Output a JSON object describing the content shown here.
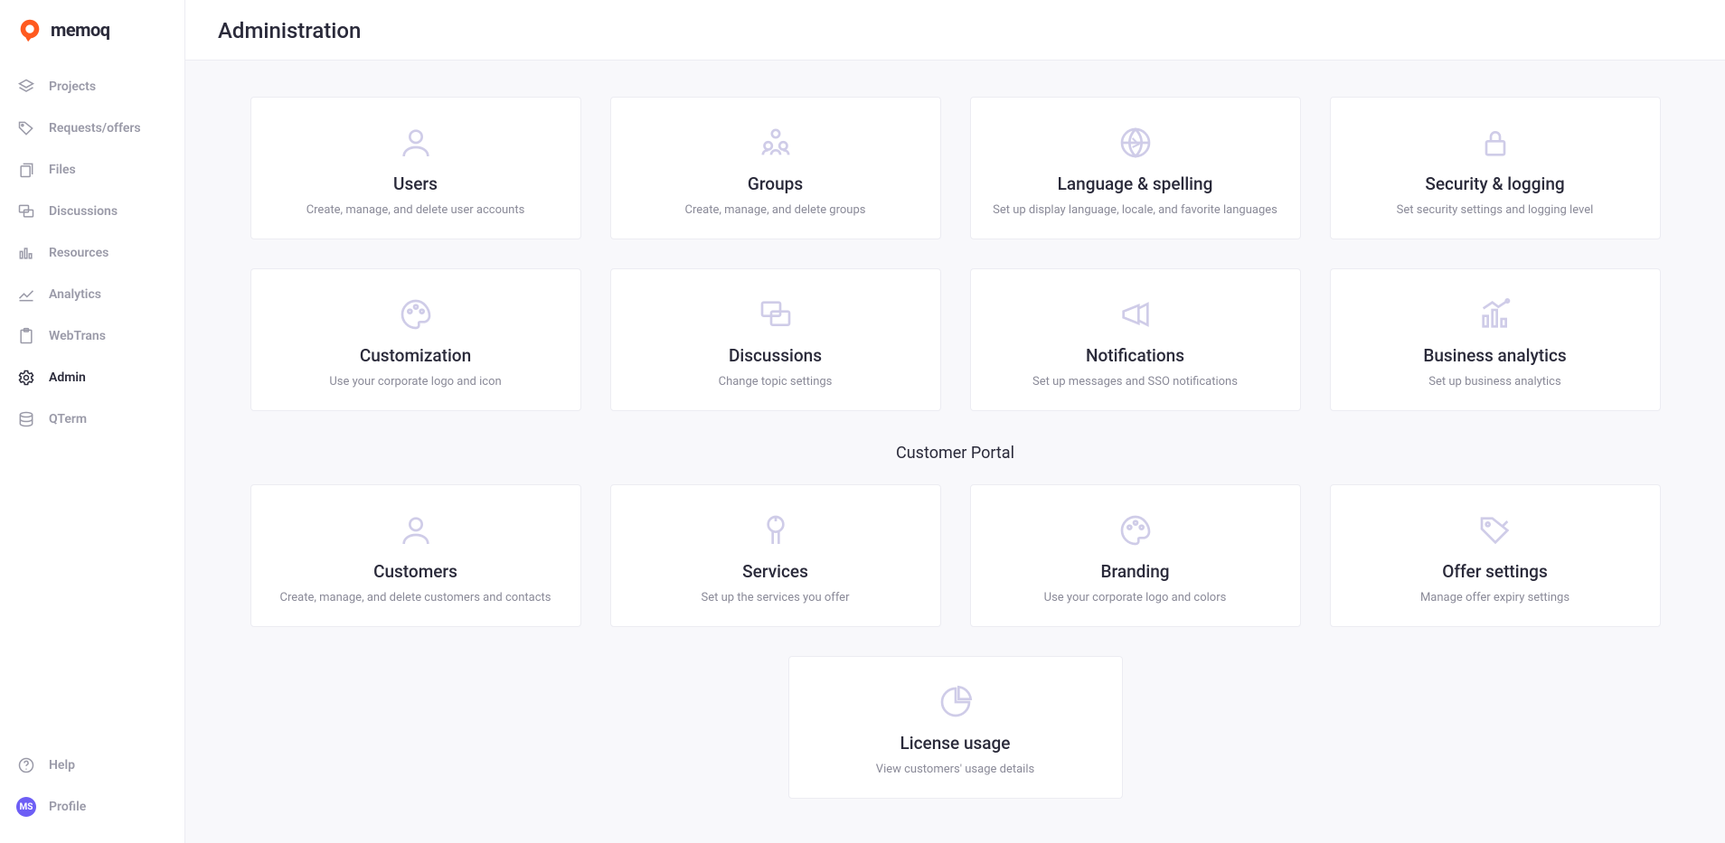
{
  "brand": {
    "name": "memoq"
  },
  "sidebar": {
    "items": [
      {
        "label": "Projects"
      },
      {
        "label": "Requests/offers"
      },
      {
        "label": "Files"
      },
      {
        "label": "Discussions"
      },
      {
        "label": "Resources"
      },
      {
        "label": "Analytics"
      },
      {
        "label": "WebTrans"
      },
      {
        "label": "Admin"
      },
      {
        "label": "QTerm"
      }
    ],
    "bottom": {
      "help": "Help",
      "profile": "Profile",
      "avatar_initials": "MS"
    }
  },
  "header": {
    "title": "Administration"
  },
  "section1": {
    "cards": [
      {
        "title": "Users",
        "desc": "Create, manage, and delete user accounts"
      },
      {
        "title": "Groups",
        "desc": "Create, manage, and delete groups"
      },
      {
        "title": "Language & spelling",
        "desc": "Set up display language, locale, and favorite languages"
      },
      {
        "title": "Security & logging",
        "desc": "Set security settings and logging level"
      },
      {
        "title": "Customization",
        "desc": "Use your corporate logo and icon"
      },
      {
        "title": "Discussions",
        "desc": "Change topic settings"
      },
      {
        "title": "Notifications",
        "desc": "Set up messages and SSO notifications"
      },
      {
        "title": "Business analytics",
        "desc": "Set up business analytics"
      }
    ]
  },
  "section2": {
    "heading": "Customer Portal",
    "cards": [
      {
        "title": "Customers",
        "desc": "Create, manage, and delete customers and contacts"
      },
      {
        "title": "Services",
        "desc": "Set up the services you offer"
      },
      {
        "title": "Branding",
        "desc": "Use your corporate logo and colors"
      },
      {
        "title": "Offer settings",
        "desc": "Manage offer expiry settings"
      }
    ],
    "last": {
      "title": "License usage",
      "desc": "View customers' usage details"
    }
  }
}
